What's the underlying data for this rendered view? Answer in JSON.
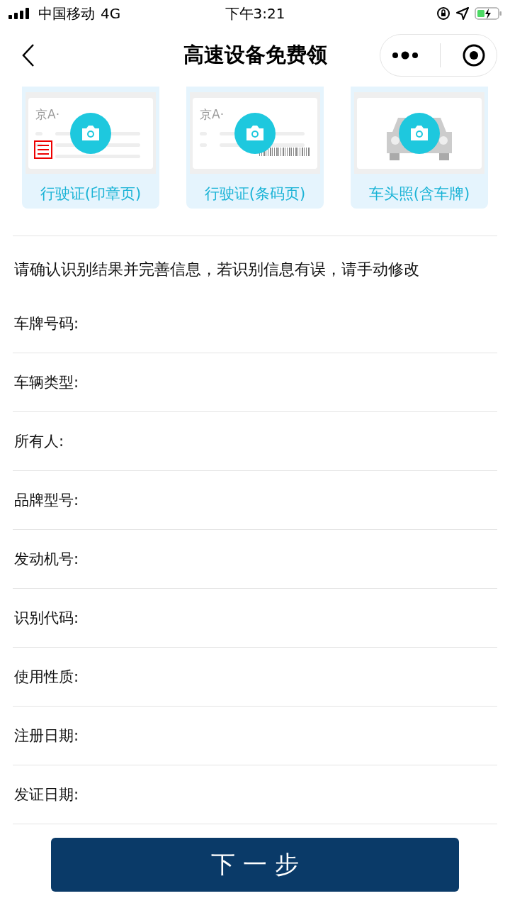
{
  "status_bar": {
    "carrier": "中国移动",
    "network": "4G",
    "time": "下午3:21"
  },
  "nav": {
    "title": "高速设备免费领"
  },
  "uploads": [
    {
      "kind": "stamp",
      "label": "行驶证(印章页)",
      "plate": "京A·"
    },
    {
      "kind": "barcode",
      "label": "行驶证(条码页)",
      "plate": "京A·"
    },
    {
      "kind": "car",
      "label": "车头照(含车牌)"
    }
  ],
  "notice": "请确认识别结果并完善信息，若识别信息有误，请手动修改",
  "fields": [
    {
      "label": "车牌号码:"
    },
    {
      "label": "车辆类型:"
    },
    {
      "label": "所有人:"
    },
    {
      "label": "品牌型号:"
    },
    {
      "label": "发动机号:"
    },
    {
      "label": "识别代码:"
    },
    {
      "label": "使用性质:"
    },
    {
      "label": "注册日期:"
    },
    {
      "label": "发证日期:"
    }
  ],
  "next_button": "下 一 步"
}
